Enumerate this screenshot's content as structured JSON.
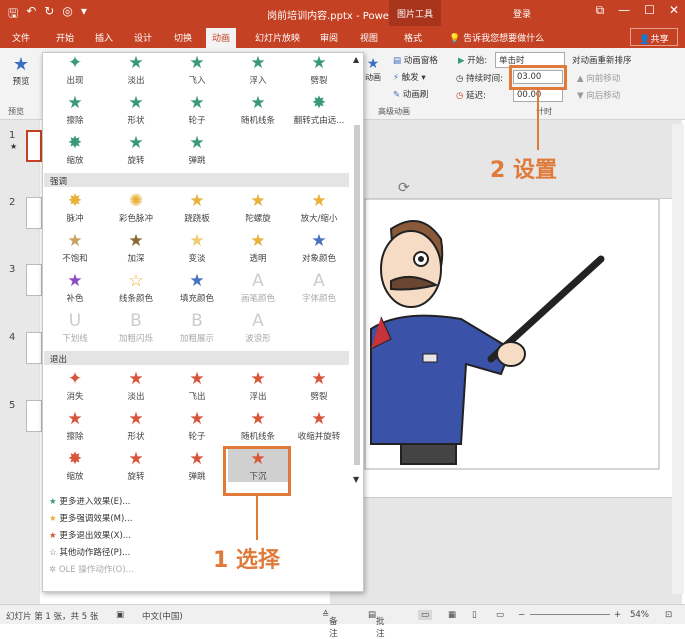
{
  "titlebar": {
    "qat_icons": [
      "save-icon",
      "undo-icon",
      "redo-icon",
      "start-from-beginning-icon",
      "customize-qat-icon"
    ],
    "title": "岗前培训内容.pptx - PowerPoint",
    "context_tab": "图片工具",
    "login": "登录"
  },
  "tabs": [
    "文件",
    "开始",
    "插入",
    "设计",
    "切换",
    "动画",
    "幻灯片放映",
    "审阅",
    "视图",
    "格式"
  ],
  "tell_me": "告诉我您想要做什么",
  "share": "共享",
  "ribbon": {
    "preview": "预览",
    "preview_group": "预览",
    "animation_pane": "动画窗格",
    "trigger": "触发",
    "anim_brush": "动画刷",
    "animation_group_btn": "动画",
    "advanced_group": "高级动画",
    "start_label": "开始:",
    "start_value": "单击时",
    "duration_label": "持续时间:",
    "duration_value": "03.00",
    "delay_label": "延迟:",
    "delay_value": "00.00",
    "reorder": "对动画重新排序",
    "move_earlier": "向前移动",
    "move_later": "向后移动",
    "timing_group": "计时"
  },
  "gallery": {
    "entrance_row1": [
      "出现",
      "淡出",
      "飞入",
      "浮入",
      "劈裂"
    ],
    "entrance_row2": [
      "擦除",
      "形状",
      "轮子",
      "随机线条",
      "翻转式由远..."
    ],
    "entrance_row3": [
      "缩放",
      "旋转",
      "弹跳"
    ],
    "emphasis_header": "强调",
    "emphasis_row1": [
      "脉冲",
      "彩色脉冲",
      "跷跷板",
      "陀螺旋",
      "放大/缩小"
    ],
    "emphasis_row2": [
      "不饱和",
      "加深",
      "变淡",
      "透明",
      "对象颜色"
    ],
    "emphasis_row3": [
      "补色",
      "线条颜色",
      "填充颜色",
      "画笔颜色",
      "字体颜色"
    ],
    "emphasis_row4": [
      "下划线",
      "加粗闪烁",
      "加粗展示",
      "波浪形"
    ],
    "exit_header": "退出",
    "exit_row1": [
      "消失",
      "淡出",
      "飞出",
      "浮出",
      "劈裂"
    ],
    "exit_row2": [
      "擦除",
      "形状",
      "轮子",
      "随机线条",
      "收缩并旋转"
    ],
    "exit_row3": [
      "缩放",
      "旋转",
      "弹跳",
      "下沉"
    ],
    "more": [
      "更多进入效果(E)...",
      "更多强调效果(M)...",
      "更多退出效果(X)...",
      "其他动作路径(P)...",
      "OLE 操作动作(O)..."
    ]
  },
  "slides": [
    "1",
    "2",
    "3",
    "4",
    "5"
  ],
  "callouts": {
    "step1": "1 选择",
    "step2": "2 设置"
  },
  "status": {
    "slide_info": "幻灯片 第 1 张，共 5 张",
    "language": "中文(中国)",
    "notes": "备注",
    "comments": "批注",
    "zoom": "54%"
  },
  "colors": {
    "accent": "#c44123",
    "entrance": "#3a9a78",
    "emphasis": "#e8b13a",
    "exit": "#d9553a",
    "callout": "#e07a3a"
  }
}
